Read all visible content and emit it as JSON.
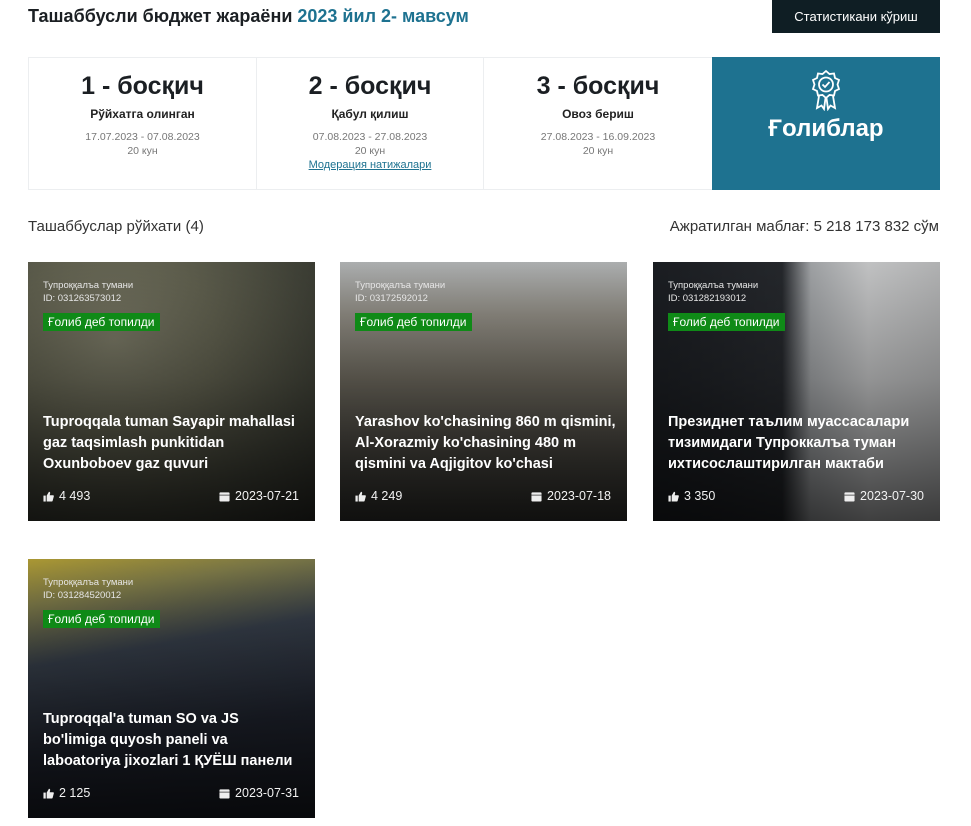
{
  "header": {
    "title_main": "Ташаббусли бюджет жараёни ",
    "title_accent": "2023 йил 2- мавсум",
    "stats_button": "Статистикани кўриш"
  },
  "stages": [
    {
      "number": "1 - босқич",
      "name": "Рўйхатга олинган",
      "dates": "17.07.2023 - 07.08.2023",
      "days": "20 кун"
    },
    {
      "number": "2 - босқич",
      "name": "Қабул қилиш",
      "dates": "07.08.2023 - 27.08.2023",
      "days": "20 кун",
      "link": "Модерация натижалари"
    },
    {
      "number": "3 - босқич",
      "name": "Овоз бериш",
      "dates": "27.08.2023 - 16.09.2023",
      "days": "20 кун"
    }
  ],
  "winners": {
    "label": "Ғолиблар",
    "icon": "award-ribbon-icon",
    "color": "#1e7290"
  },
  "list": {
    "title": "Ташаббуслар рўйхати (4)",
    "budget": "Ажратилган маблағ: 5 218 173 832 сўм"
  },
  "cards": [
    {
      "district": "Тупроққалъа тумани",
      "id": "ID: 031263573012",
      "badge": "Ғолиб деб топилди",
      "title": "Tuproqqala tuman Sayapir mahallasi gaz taqsimlash punkitidan Oxunboboev gaz quvuri",
      "likes": "4 493",
      "date": "2023-07-21"
    },
    {
      "district": "Тупроққалъа тумани",
      "id": "ID: 03172592012",
      "badge": "Ғолиб деб топилди",
      "title": "Yarashov ko'chasining 860 m qismini, Al-Xorazmiy ko'chasining 480 m qismini va Aqjigitov ko'chasi",
      "likes": "4 249",
      "date": "2023-07-18"
    },
    {
      "district": "Тупроққалъа тумани",
      "id": "ID: 031282193012",
      "badge": "Ғолиб деб топилди",
      "title": "Президнет таълим муассасалари тизимидаги Тупроккалъа туман ихтисослаштирилган мактаби",
      "likes": "3 350",
      "date": "2023-07-30"
    },
    {
      "district": "Тупроққалъа тумани",
      "id": "ID: 031284520012",
      "badge": "Ғолиб деб топилди",
      "title": "Tuproqqal'a tuman SO va JS bo'limiga quyosh paneli va laboatoriya jixozlari 1 ҚУЁШ панели",
      "likes": "2 125",
      "date": "2023-07-31"
    }
  ]
}
